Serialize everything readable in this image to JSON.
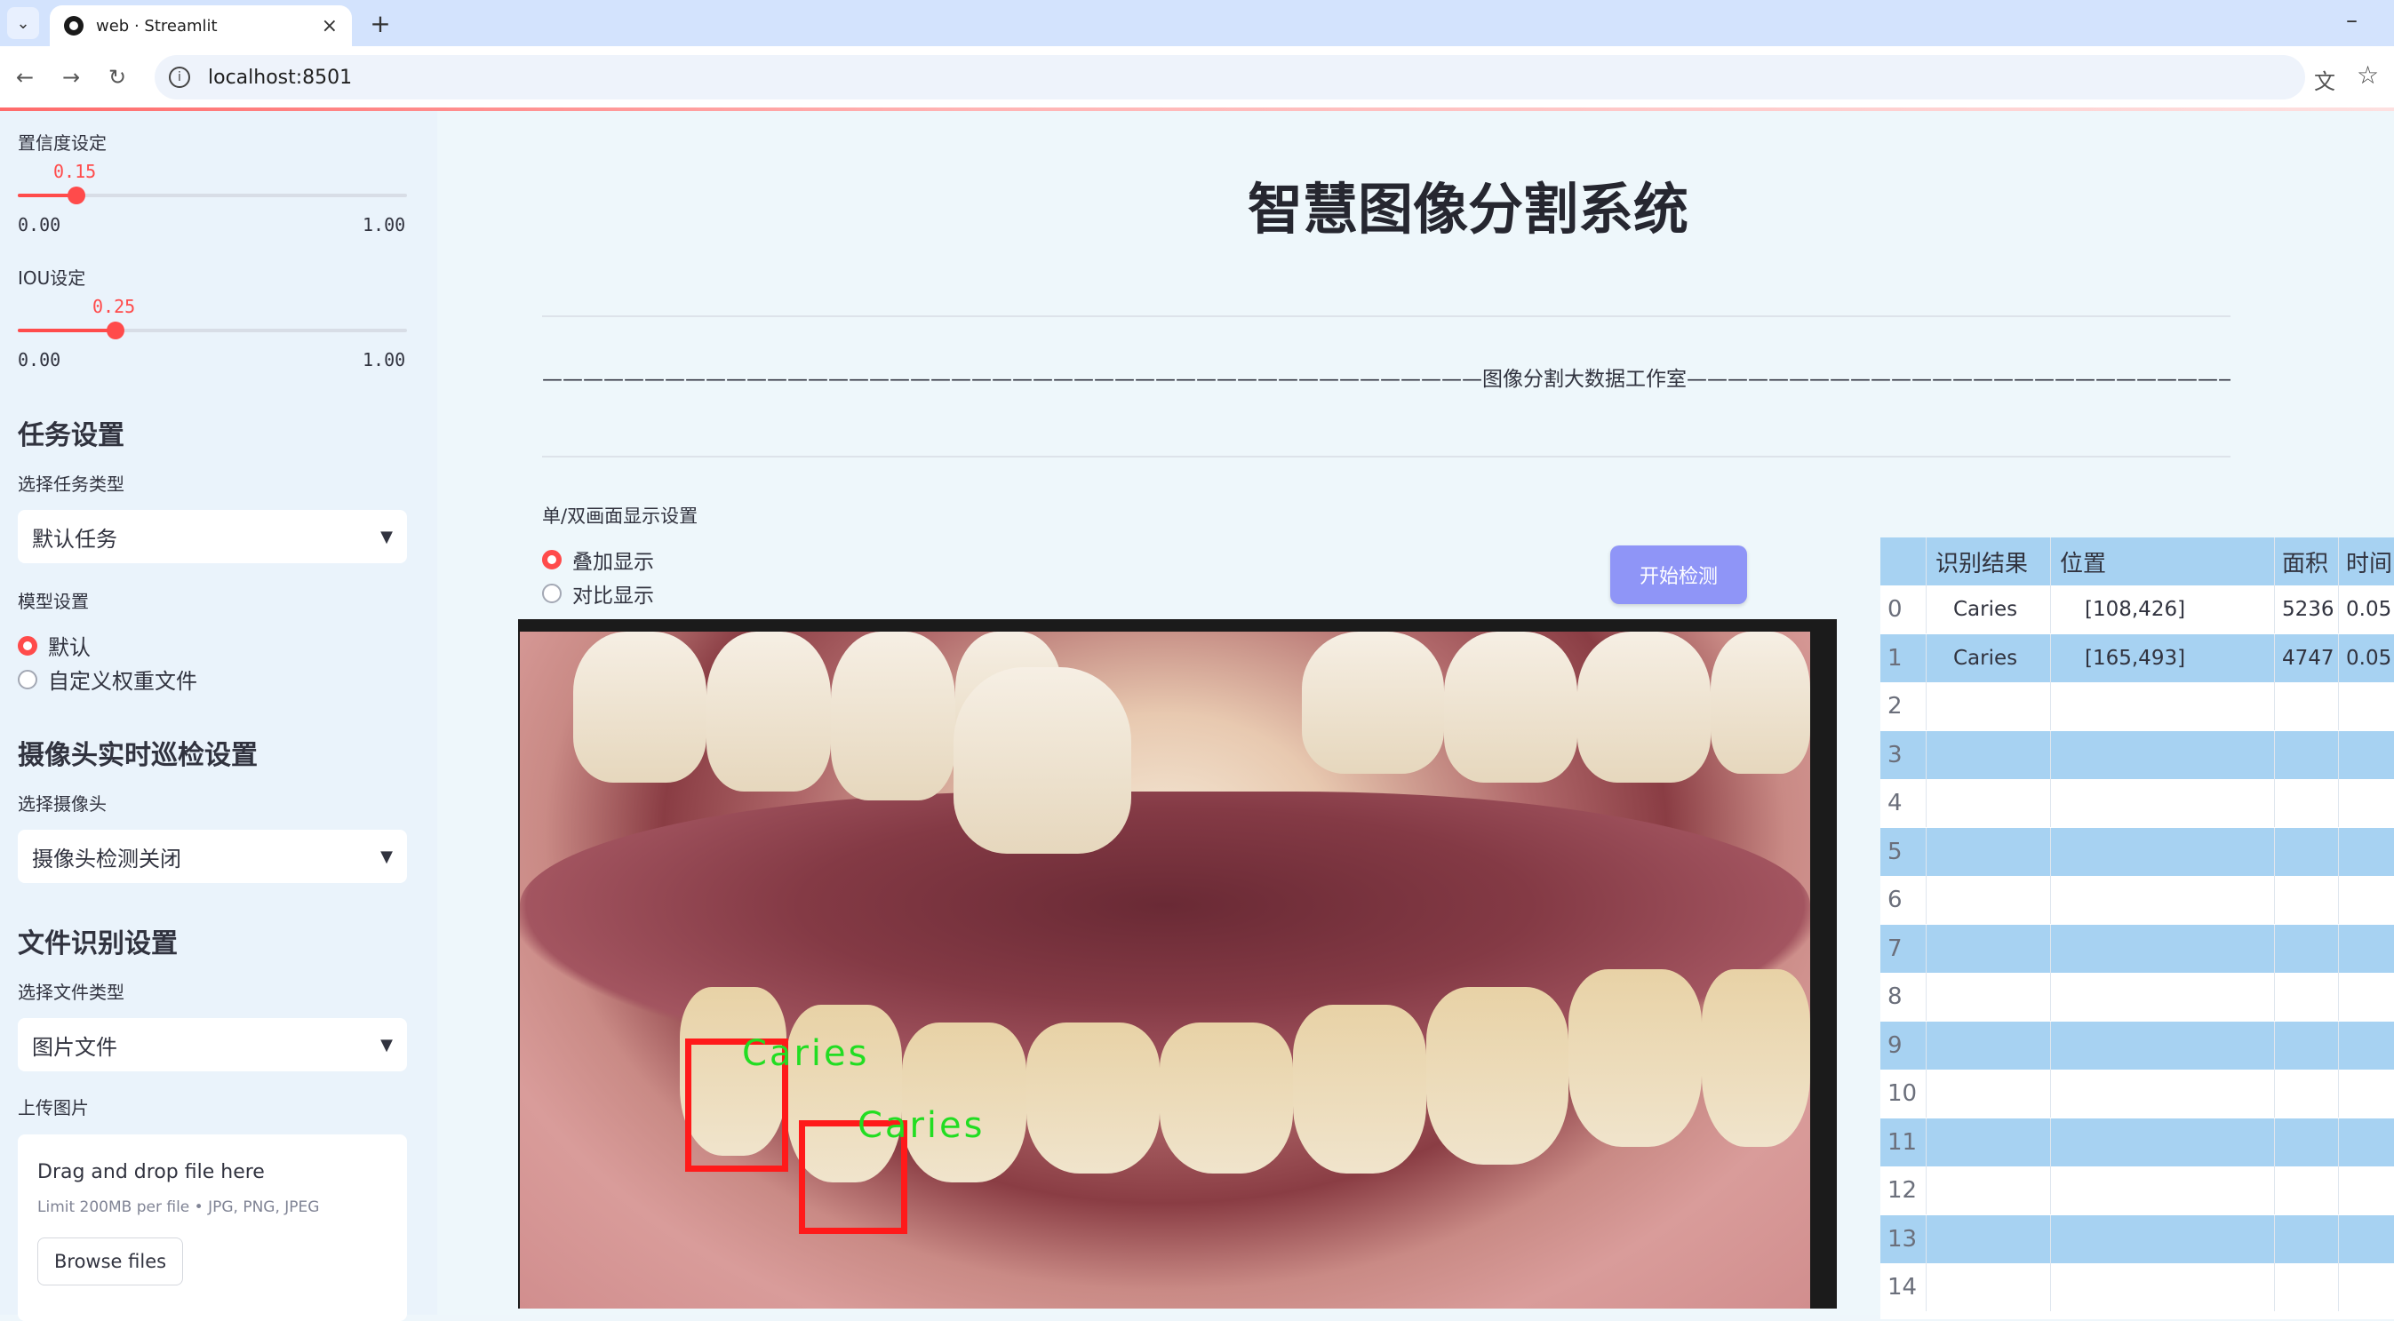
{
  "browser": {
    "tab_title": "web · Streamlit",
    "url": "localhost:8501"
  },
  "sidebar": {
    "confidence": {
      "label": "置信度设定",
      "value": "0.15",
      "min": "0.00",
      "max": "1.00",
      "fraction": 0.15
    },
    "iou": {
      "label": "IOU设定",
      "value": "0.25",
      "min": "0.00",
      "max": "1.00",
      "fraction": 0.25
    },
    "task_header": "任务设置",
    "task_type_label": "选择任务类型",
    "task_type_value": "默认任务",
    "model_label": "模型设置",
    "model_options": [
      "默认",
      "自定义权重文件"
    ],
    "camera_header": "摄像头实时巡检设置",
    "camera_label": "选择摄像头",
    "camera_value": "摄像头检测关闭",
    "file_header": "文件识别设置",
    "file_type_label": "选择文件类型",
    "file_type_value": "图片文件",
    "upload_label": "上传图片",
    "upload_drag": "Drag and drop file here",
    "upload_limit": "Limit 200MB per file • JPG, PNG, JPEG",
    "upload_button": "Browse files"
  },
  "main": {
    "title": "智慧图像分割系统",
    "studio_line": "——————————————————————————————————————————————图像分割大数据工作室——————————————————————————————————————————————",
    "display_label": "单/双画面显示设置",
    "display_options": [
      "叠加显示",
      "对比显示"
    ],
    "start_button": "开始检测",
    "detections": [
      {
        "label": "Caries"
      },
      {
        "label": "Caries"
      }
    ]
  },
  "table": {
    "columns": [
      "",
      "识别结果",
      "位置",
      "面积",
      "时间"
    ],
    "rows": [
      [
        "0",
        "Caries",
        "[108,426]",
        "5236",
        "0.05"
      ],
      [
        "1",
        "Caries",
        "[165,493]",
        "4747",
        "0.05"
      ],
      [
        "2",
        "",
        "",
        "",
        ""
      ],
      [
        "3",
        "",
        "",
        "",
        ""
      ],
      [
        "4",
        "",
        "",
        "",
        ""
      ],
      [
        "5",
        "",
        "",
        "",
        ""
      ],
      [
        "6",
        "",
        "",
        "",
        ""
      ],
      [
        "7",
        "",
        "",
        "",
        ""
      ],
      [
        "8",
        "",
        "",
        "",
        ""
      ],
      [
        "9",
        "",
        "",
        "",
        ""
      ],
      [
        "10",
        "",
        "",
        "",
        ""
      ],
      [
        "11",
        "",
        "",
        "",
        ""
      ],
      [
        "12",
        "",
        "",
        "",
        ""
      ],
      [
        "13",
        "",
        "",
        "",
        ""
      ],
      [
        "14",
        "",
        "",
        "",
        ""
      ]
    ]
  },
  "colors": {
    "accent": "#ff4b4b",
    "button": "#8f95f7",
    "table_stripe": "#a7d2f2",
    "detection_box": "#ff1a1a",
    "detection_text": "#22dd22"
  }
}
